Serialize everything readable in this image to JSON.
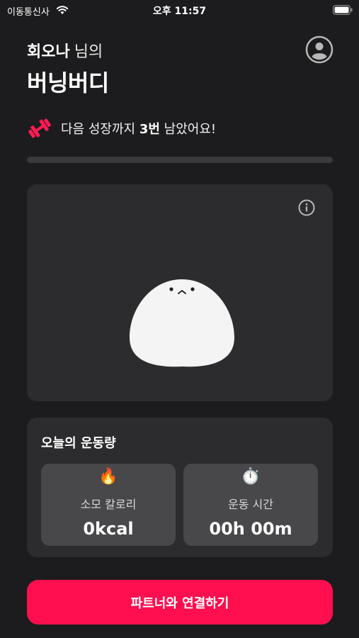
{
  "status_bar": {
    "carrier": "이동통신사",
    "time": "오후 11:57",
    "wifi_icon": "wifi-icon",
    "battery_icon": "battery-icon"
  },
  "header": {
    "user_name": "회오나",
    "name_suffix": "님의",
    "app_title": "버닝버디",
    "profile_icon": "person-circle-icon"
  },
  "growth": {
    "icon": "dumbbell-icon",
    "prefix": "다음 성장까지",
    "count": "3번",
    "suffix": "남았어요!",
    "progress": 0
  },
  "character_card": {
    "info_icon": "info-icon",
    "character": "buddy-character"
  },
  "daily": {
    "title": "오늘의 운동량",
    "calories": {
      "icon": "🔥",
      "label": "소모 칼로리",
      "value": "0kcal"
    },
    "duration": {
      "icon": "⏱️",
      "label": "운동 시간",
      "value": "00h 00m"
    }
  },
  "cta": {
    "label": "파트너와 연결하기"
  },
  "colors": {
    "accent": "#ff0f4f",
    "background": "#1c1c1e",
    "card": "#2c2c2e",
    "tile": "#48484a"
  }
}
